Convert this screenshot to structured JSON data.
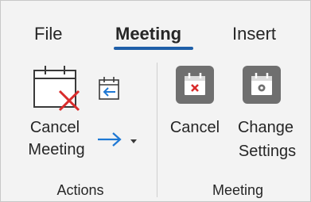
{
  "tabs": [
    {
      "label": "File"
    },
    {
      "label": "Meeting"
    },
    {
      "label": "Insert"
    }
  ],
  "actions_group": {
    "cancel_meeting_line1": "Cancel",
    "cancel_meeting_line2": "Meeting",
    "group_label": "Actions"
  },
  "meeting_group": {
    "cancel_label": "Cancel",
    "change_settings_line1": "Change",
    "change_settings_line2": "Settings",
    "group_label": "Meeting"
  },
  "colors": {
    "accent": "#1f5fa8",
    "forward_arrow": "#1e78d4",
    "cancel_red": "#d92b2b",
    "disabled_tile": "#6f6f6f"
  },
  "icons": [
    "calendar-cancel-icon",
    "calendar-forward-icon",
    "forward-arrow-icon",
    "dropdown-caret-icon",
    "calendar-x-icon",
    "calendar-settings-icon"
  ]
}
